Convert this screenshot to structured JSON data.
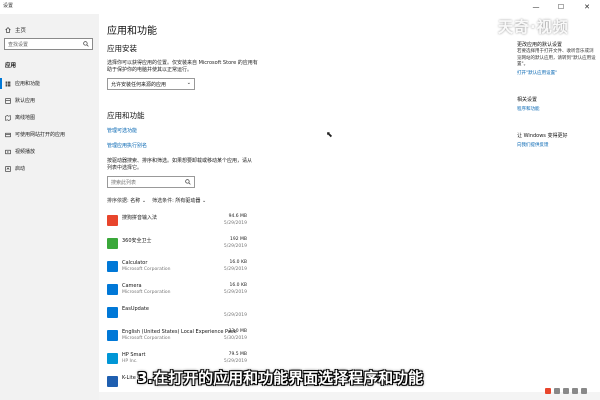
{
  "window": {
    "title": "设置",
    "minimize": "—",
    "maximize": "☐",
    "close": "✕"
  },
  "sidebar": {
    "home": "主页",
    "search_placeholder": "查找设置",
    "group": "应用",
    "items": [
      {
        "label": "应用和功能",
        "icon": "apps-list-icon"
      },
      {
        "label": "默认应用",
        "icon": "default-apps-icon"
      },
      {
        "label": "离线地图",
        "icon": "offline-maps-icon"
      },
      {
        "label": "可使用网站打开的应用",
        "icon": "apps-for-websites-icon"
      },
      {
        "label": "视频播放",
        "icon": "video-playback-icon"
      },
      {
        "label": "启动",
        "icon": "startup-icon"
      }
    ]
  },
  "main": {
    "title": "应用和功能",
    "install_heading": "应用安装",
    "install_desc_1": "选择你可以获得应用的位置。仅安装来自 Microsoft Store 的应用有",
    "install_desc_2": "助于保护你的电脑并使其以正常运行。",
    "install_dropdown": "允许安装任何来源的应用",
    "features_heading": "应用和功能",
    "link_optional": "管理可选功能",
    "link_aliases": "管理应用执行别名",
    "search_desc_1": "按驱动器搜索、排序和筛选。如果想要卸载或移动某个应用，请从",
    "search_desc_2": "列表中选择它。",
    "search_placeholder": "搜索此列表",
    "sort_label": "排序依据:",
    "sort_value": "名称",
    "filter_label": "筛选条件:",
    "filter_value": "所有驱动器",
    "apps": [
      {
        "name": "搜狗拼音输入法",
        "publisher": "",
        "size": "94.6 MB",
        "date": "5/29/2019",
        "color": "#e8452c"
      },
      {
        "name": "360安全卫士",
        "publisher": "",
        "size": "192 MB",
        "date": "5/29/2019",
        "color": "#3aa83a"
      },
      {
        "name": "Calculator",
        "publisher": "Microsoft Corporation",
        "size": "16.0 KB",
        "date": "5/29/2019",
        "color": "#0078d7"
      },
      {
        "name": "Camera",
        "publisher": "Microsoft Corporation",
        "size": "16.0 KB",
        "date": "5/29/2019",
        "color": "#0078d7"
      },
      {
        "name": "EasUpdate",
        "publisher": "",
        "size": "",
        "date": "5/29/2019",
        "color": "#0078d7"
      },
      {
        "name": "English (United States) Local Experience Pack",
        "publisher": "Microsoft Corporation",
        "size": "33.0 MB",
        "date": "5/30/2019",
        "color": "#0078d7"
      },
      {
        "name": "HP Smart",
        "publisher": "HP Inc.",
        "size": "79.5 MB",
        "date": "5/29/2019",
        "color": "#0096d6"
      },
      {
        "name": "K-Lite Co",
        "publisher": "",
        "size": "",
        "date": "",
        "color": "#1f5fb0"
      }
    ]
  },
  "right_panel": {
    "heading": "更改应用的默认设置",
    "desc": "若要选择用于打开文件、收听音乐或浏览网站的默认应用，请转到\"默认应用设置\"。",
    "link_default": "打开\"默认应用设置\"",
    "related_heading": "相关设置",
    "related_link": "程序和功能",
    "better_heading": "让 Windows 变得更好",
    "better_link": "向我们提供反馈"
  },
  "overlay": {
    "watermark": "天奇·视频",
    "caption": "3.在打开的应用和功能界面选择程序和功能"
  }
}
